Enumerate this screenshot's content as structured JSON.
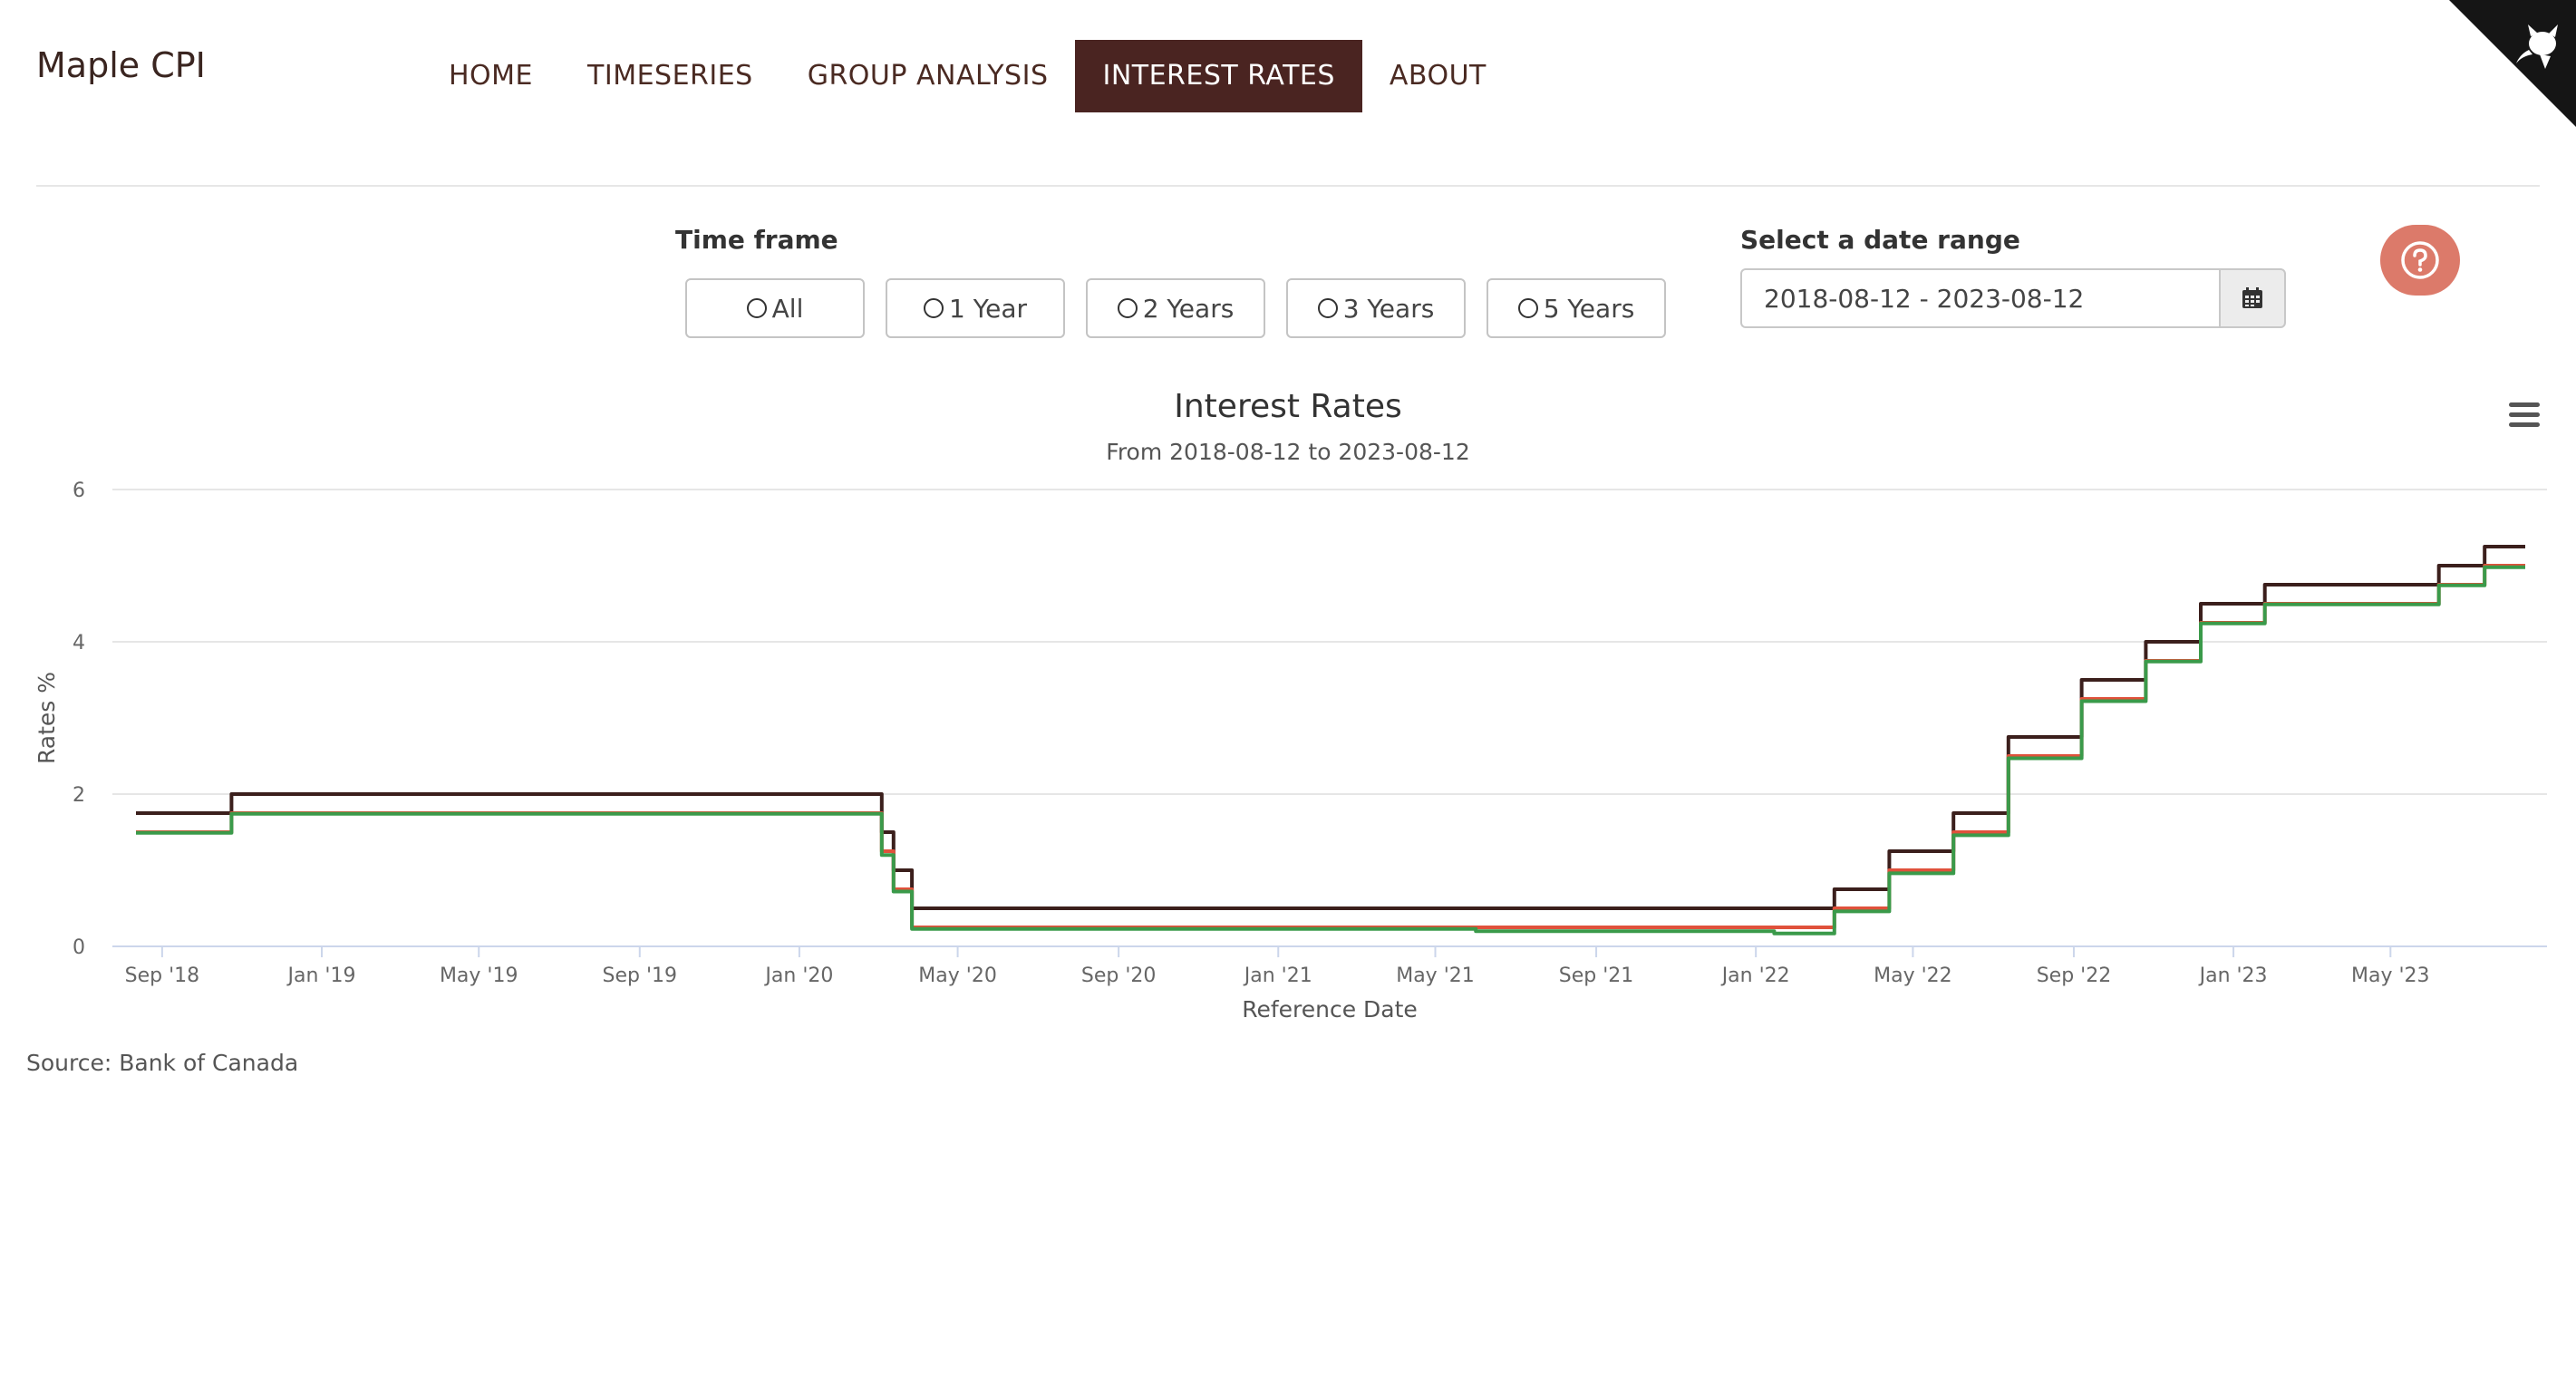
{
  "brand": "Maple CPI",
  "nav": {
    "items": [
      {
        "label": "HOME",
        "active": false
      },
      {
        "label": "TIMESERIES",
        "active": false
      },
      {
        "label": "GROUP ANALYSIS",
        "active": false
      },
      {
        "label": "INTEREST RATES",
        "active": true
      },
      {
        "label": "ABOUT",
        "active": false
      }
    ]
  },
  "time_frame": {
    "label": "Time frame",
    "options": [
      "All",
      "1 Year",
      "2 Years",
      "3 Years",
      "5 Years"
    ]
  },
  "date_range": {
    "label": "Select a date range",
    "value": "2018-08-12 - 2023-08-12"
  },
  "colors": {
    "accent_dark": "#4a2421",
    "help_button": "#dc7a6a",
    "series_dark": "#3b1f1c",
    "series_red": "#e0513b",
    "series_green": "#3a9a4a"
  },
  "chart_data": {
    "type": "line",
    "title": "Interest Rates",
    "subtitle": "From 2018-08-12 to 2023-08-12",
    "xlabel": "Reference Date",
    "ylabel": "Rates %",
    "ylim": [
      0,
      6
    ],
    "yticks": [
      0,
      2,
      4,
      6
    ],
    "xlim": [
      "2018-08-12",
      "2023-08-12"
    ],
    "xticks": [
      {
        "date": "2018-09-01",
        "label": "Sep '18"
      },
      {
        "date": "2019-01-01",
        "label": "Jan '19"
      },
      {
        "date": "2019-05-01",
        "label": "May '19"
      },
      {
        "date": "2019-09-01",
        "label": "Sep '19"
      },
      {
        "date": "2020-01-01",
        "label": "Jan '20"
      },
      {
        "date": "2020-05-01",
        "label": "May '20"
      },
      {
        "date": "2020-09-01",
        "label": "Sep '20"
      },
      {
        "date": "2021-01-01",
        "label": "Jan '21"
      },
      {
        "date": "2021-05-01",
        "label": "May '21"
      },
      {
        "date": "2021-09-01",
        "label": "Sep '21"
      },
      {
        "date": "2022-01-01",
        "label": "Jan '22"
      },
      {
        "date": "2022-05-01",
        "label": "May '22"
      },
      {
        "date": "2022-09-01",
        "label": "Sep '22"
      },
      {
        "date": "2023-01-01",
        "label": "Jan '23"
      },
      {
        "date": "2023-05-01",
        "label": "May '23"
      }
    ],
    "grid": true,
    "series": [
      {
        "color": "#3b1f1c",
        "points": [
          [
            "2018-08-12",
            1.75
          ],
          [
            "2018-10-24",
            2.0
          ],
          [
            "2020-03-04",
            1.5
          ],
          [
            "2020-03-13",
            1.0
          ],
          [
            "2020-03-27",
            0.5
          ],
          [
            "2022-03-02",
            0.75
          ],
          [
            "2022-04-13",
            1.25
          ],
          [
            "2022-06-01",
            1.75
          ],
          [
            "2022-07-13",
            2.75
          ],
          [
            "2022-09-07",
            3.5
          ],
          [
            "2022-10-26",
            4.0
          ],
          [
            "2022-12-07",
            4.5
          ],
          [
            "2023-01-25",
            4.75
          ],
          [
            "2023-06-07",
            5.0
          ],
          [
            "2023-07-12",
            5.25
          ],
          [
            "2023-08-12",
            5.25
          ]
        ]
      },
      {
        "color": "#e0513b",
        "points": [
          [
            "2018-08-12",
            1.5
          ],
          [
            "2018-10-24",
            1.75
          ],
          [
            "2020-03-04",
            1.25
          ],
          [
            "2020-03-13",
            0.75
          ],
          [
            "2020-03-27",
            0.25
          ],
          [
            "2022-03-02",
            0.5
          ],
          [
            "2022-04-13",
            1.0
          ],
          [
            "2022-06-01",
            1.5
          ],
          [
            "2022-07-13",
            2.5
          ],
          [
            "2022-09-07",
            3.25
          ],
          [
            "2022-10-26",
            3.75
          ],
          [
            "2022-12-07",
            4.25
          ],
          [
            "2023-01-25",
            4.5
          ],
          [
            "2023-06-07",
            4.75
          ],
          [
            "2023-07-12",
            5.0
          ],
          [
            "2023-08-12",
            5.0
          ]
        ]
      },
      {
        "color": "#3a9a4a",
        "points": [
          [
            "2018-08-12",
            1.49
          ],
          [
            "2018-10-24",
            1.74
          ],
          [
            "2020-03-04",
            1.2
          ],
          [
            "2020-03-13",
            0.72
          ],
          [
            "2020-03-27",
            0.23
          ],
          [
            "2021-06-01",
            0.2
          ],
          [
            "2022-01-15",
            0.17
          ],
          [
            "2022-03-02",
            0.46
          ],
          [
            "2022-04-13",
            0.96
          ],
          [
            "2022-06-01",
            1.46
          ],
          [
            "2022-07-13",
            2.47
          ],
          [
            "2022-09-07",
            3.22
          ],
          [
            "2022-10-26",
            3.74
          ],
          [
            "2022-12-07",
            4.24
          ],
          [
            "2023-01-25",
            4.49
          ],
          [
            "2023-06-07",
            4.74
          ],
          [
            "2023-07-12",
            4.98
          ],
          [
            "2023-08-12",
            4.98
          ]
        ]
      }
    ]
  },
  "source": "Source: Bank of Canada"
}
